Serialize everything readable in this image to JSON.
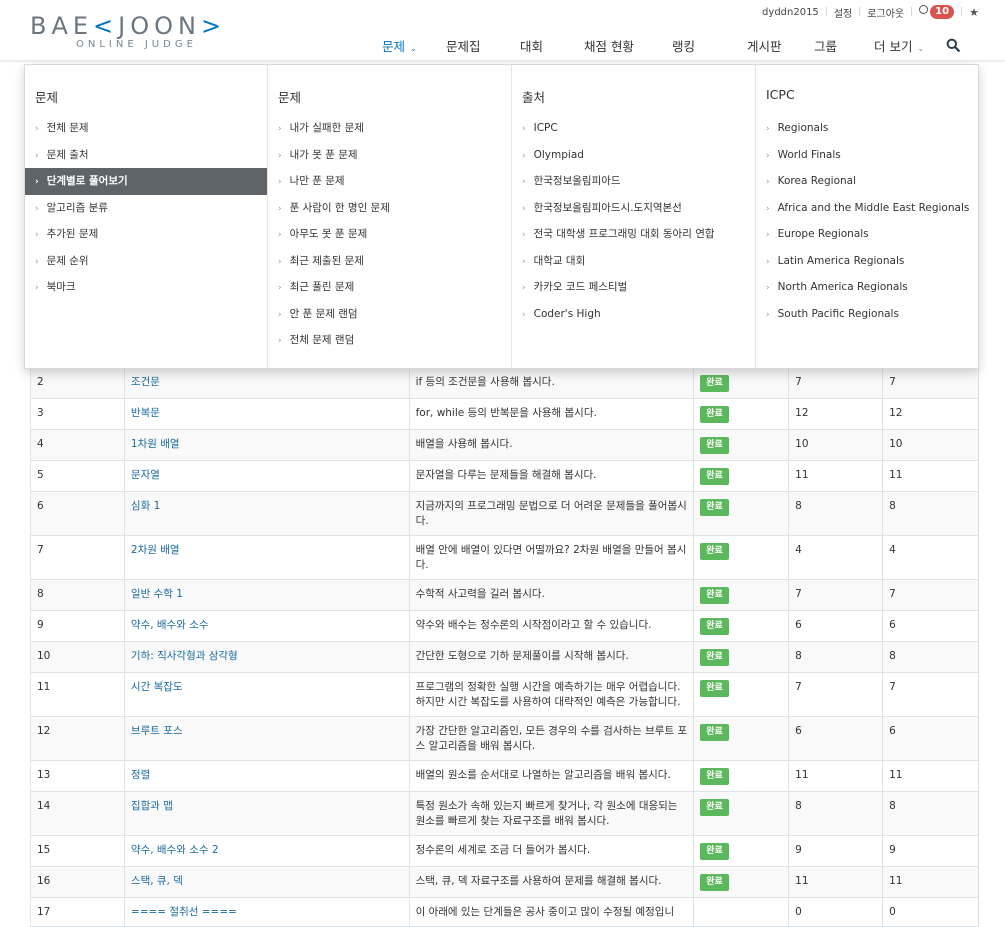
{
  "brand": {
    "name_part1": "BAE",
    "name_part2": "JOON",
    "subtitle": "ONLINE JUDGE"
  },
  "topbar": {
    "username": "dyddn2015",
    "settings": "설정",
    "logout": "로그아웃",
    "notifications": "10"
  },
  "nav": {
    "items": [
      {
        "label": "문제",
        "caret": true,
        "active": true
      },
      {
        "label": "문제집"
      },
      {
        "label": "대회"
      },
      {
        "label": "채점 현황"
      },
      {
        "label": "랭킹"
      },
      {
        "label": "게시판"
      },
      {
        "label": "그룹"
      },
      {
        "label": "더 보기",
        "caret": true
      }
    ]
  },
  "menu": {
    "columns": [
      {
        "heading": "문제",
        "items": [
          "전체 문제",
          "문제 출처",
          "단계별로 풀어보기",
          "알고리즘 분류",
          "추가된 문제",
          "문제 순위",
          "북마크"
        ],
        "active_index": 2
      },
      {
        "heading": "문제",
        "items": [
          "내가 실패한 문제",
          "내가 못 푼 문제",
          "나만 푼 문제",
          "푼 사람이 한 명인 문제",
          "아무도 못 푼 문제",
          "최근 제출된 문제",
          "최근 풀린 문제",
          "안 푼 문제 랜덤",
          "전체 문제 랜덤"
        ]
      },
      {
        "heading": "출처",
        "items": [
          "ICPC",
          "Olympiad",
          "한국정보올림피아드",
          "한국정보올림피아드시.도지역본선",
          "전국 대학생 프로그래밍 대회 동아리 연합",
          "대학교 대회",
          "카카오 코드 페스티벌",
          "Coder's High"
        ]
      },
      {
        "heading": "ICPC",
        "items": [
          "Regionals",
          "World Finals",
          "Korea Regional",
          "Africa and the Middle East Regionals",
          "Europe Regionals",
          "Latin America Regionals",
          "North America Regionals",
          "South Pacific Regionals"
        ]
      }
    ]
  },
  "steps": {
    "status_label": "완료",
    "rows": [
      {
        "no": "2",
        "title": "조건문",
        "desc": "if 등의 조건문을 사용해 봅시다.",
        "done": true,
        "total": "7",
        "solved": "7"
      },
      {
        "no": "3",
        "title": "반복문",
        "desc": "for, while 등의 반복문을 사용해 봅시다.",
        "done": true,
        "total": "12",
        "solved": "12"
      },
      {
        "no": "4",
        "title": "1차원 배열",
        "desc": "배열을 사용해 봅시다.",
        "done": true,
        "total": "10",
        "solved": "10"
      },
      {
        "no": "5",
        "title": "문자열",
        "desc": "문자열을 다루는 문제들을 해결해 봅시다.",
        "done": true,
        "total": "11",
        "solved": "11"
      },
      {
        "no": "6",
        "title": "심화 1",
        "desc": "지금까지의 프로그래밍 문법으로 더 어려운 문제들을 풀어봅시다.",
        "done": true,
        "total": "8",
        "solved": "8"
      },
      {
        "no": "7",
        "title": "2차원 배열",
        "desc": "배열 안에 배열이 있다면 어떨까요? 2차원 배열을 만들어 봅시다.",
        "done": true,
        "total": "4",
        "solved": "4"
      },
      {
        "no": "8",
        "title": "일반 수학 1",
        "desc": "수학적 사고력을 길러 봅시다.",
        "done": true,
        "total": "7",
        "solved": "7"
      },
      {
        "no": "9",
        "title": "약수, 배수와 소수",
        "desc": "약수와 배수는 정수론의 시작점이라고 할 수 있습니다.",
        "done": true,
        "total": "6",
        "solved": "6"
      },
      {
        "no": "10",
        "title": "기하: 직사각형과 삼각형",
        "desc": "간단한 도형으로 기하 문제풀이를 시작해 봅시다.",
        "done": true,
        "total": "8",
        "solved": "8"
      },
      {
        "no": "11",
        "title": "시간 복잡도",
        "desc": "프로그램의 정확한 실행 시간을 예측하기는 매우 어렵습니다. 하지만 시간 복잡도를 사용하여 대략적인 예측은 가능합니다.",
        "done": true,
        "total": "7",
        "solved": "7"
      },
      {
        "no": "12",
        "title": "브루트 포스",
        "desc": "가장 간단한 알고리즘인, 모든 경우의 수를 검사하는 브루트 포스 알고리즘을 배워 봅시다.",
        "done": true,
        "total": "6",
        "solved": "6"
      },
      {
        "no": "13",
        "title": "정렬",
        "desc": "배열의 원소를 순서대로 나열하는 알고리즘을 배워 봅시다.",
        "done": true,
        "total": "11",
        "solved": "11"
      },
      {
        "no": "14",
        "title": "집합과 맵",
        "desc": "특정 원소가 속해 있는지 빠르게 찾거나, 각 원소에 대응되는 원소를 빠르게 찾는 자료구조를 배워 봅시다.",
        "done": true,
        "total": "8",
        "solved": "8"
      },
      {
        "no": "15",
        "title": "약수, 배수와 소수 2",
        "desc": "정수론의 세계로 조금 더 들어가 봅시다.",
        "done": true,
        "total": "9",
        "solved": "9"
      },
      {
        "no": "16",
        "title": "스택, 큐, 덱",
        "desc": "스택, 큐, 덱 자료구조를 사용하여 문제를 해결해 봅시다.",
        "done": true,
        "total": "11",
        "solved": "11"
      },
      {
        "no": "17",
        "title": "==== 절취선 ====",
        "desc": "이 아래에 있는 단계들은 공사 중이고 많이 수정될 예정입니",
        "done": false,
        "total": "0",
        "solved": "0"
      }
    ]
  },
  "colors": {
    "link": "#1a6ba0",
    "accent": "#0076c0",
    "done_green": "#5cb85c",
    "menu_active_bg": "#5f6468"
  },
  "icons": {
    "search": "search-icon",
    "globe": "globe-icon",
    "star": "star-icon",
    "chevron": "chevron-right-icon"
  }
}
